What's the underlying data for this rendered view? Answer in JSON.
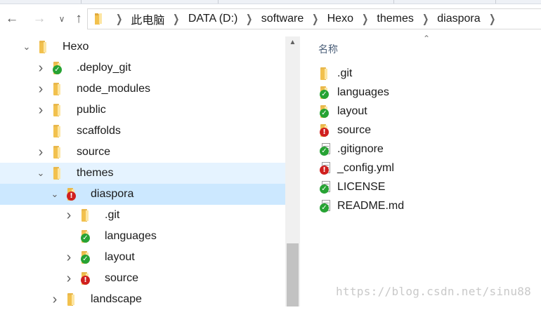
{
  "breadcrumb": [
    {
      "label": "此电脑"
    },
    {
      "label": "DATA (D:)"
    },
    {
      "label": "software"
    },
    {
      "label": "Hexo"
    },
    {
      "label": "themes"
    },
    {
      "label": "diaspora"
    }
  ],
  "navigation": {
    "back_icon": "back-arrow-icon",
    "forward_icon": "forward-arrow-icon",
    "dropdown_icon": "chevron-down-icon",
    "up_icon": "up-arrow-icon"
  },
  "nav_tree": [
    {
      "label": "Hexo",
      "expander": "expanded",
      "status": "none",
      "style": "normal"
    },
    {
      "label": ".deploy_git",
      "expander": "collapsed",
      "status": "ok",
      "style": "normal"
    },
    {
      "label": "node_modules",
      "expander": "collapsed",
      "status": "none",
      "style": "normal"
    },
    {
      "label": "public",
      "expander": "collapsed",
      "status": "none",
      "style": "normal"
    },
    {
      "label": "scaffolds",
      "expander": "none",
      "status": "none",
      "style": "normal"
    },
    {
      "label": "source",
      "expander": "collapsed",
      "status": "none",
      "style": "normal"
    },
    {
      "label": "themes",
      "expander": "expanded",
      "status": "none",
      "style": "hover"
    },
    {
      "label": "diaspora",
      "expander": "expanded",
      "status": "error",
      "style": "selected"
    },
    {
      "label": ".git",
      "expander": "collapsed",
      "status": "none",
      "style": "normal"
    },
    {
      "label": "languages",
      "expander": "none",
      "status": "ok",
      "style": "normal"
    },
    {
      "label": "layout",
      "expander": "collapsed",
      "status": "ok",
      "style": "normal"
    },
    {
      "label": "source",
      "expander": "collapsed",
      "status": "error",
      "style": "normal"
    },
    {
      "label": "landscape",
      "expander": "collapsed",
      "status": "none",
      "style": "normal"
    }
  ],
  "file_list": {
    "column_header": "名称",
    "items": [
      {
        "name": ".git",
        "type": "folder",
        "status": "none"
      },
      {
        "name": "languages",
        "type": "folder",
        "status": "ok"
      },
      {
        "name": "layout",
        "type": "folder",
        "status": "ok"
      },
      {
        "name": "source",
        "type": "folder",
        "status": "error"
      },
      {
        "name": ".gitignore",
        "type": "file",
        "status": "ok"
      },
      {
        "name": "_config.yml",
        "type": "file",
        "status": "error"
      },
      {
        "name": "LICENSE",
        "type": "file",
        "status": "ok"
      },
      {
        "name": "README.md",
        "type": "file",
        "status": "ok"
      }
    ]
  },
  "watermark": "https://blog.csdn.net/sinu88",
  "colors": {
    "hover_row": "#e5f3ff",
    "selected_row": "#cce8ff",
    "status_ok": "#27a334",
    "status_error": "#d0201f",
    "folder": "#f2c14e"
  }
}
